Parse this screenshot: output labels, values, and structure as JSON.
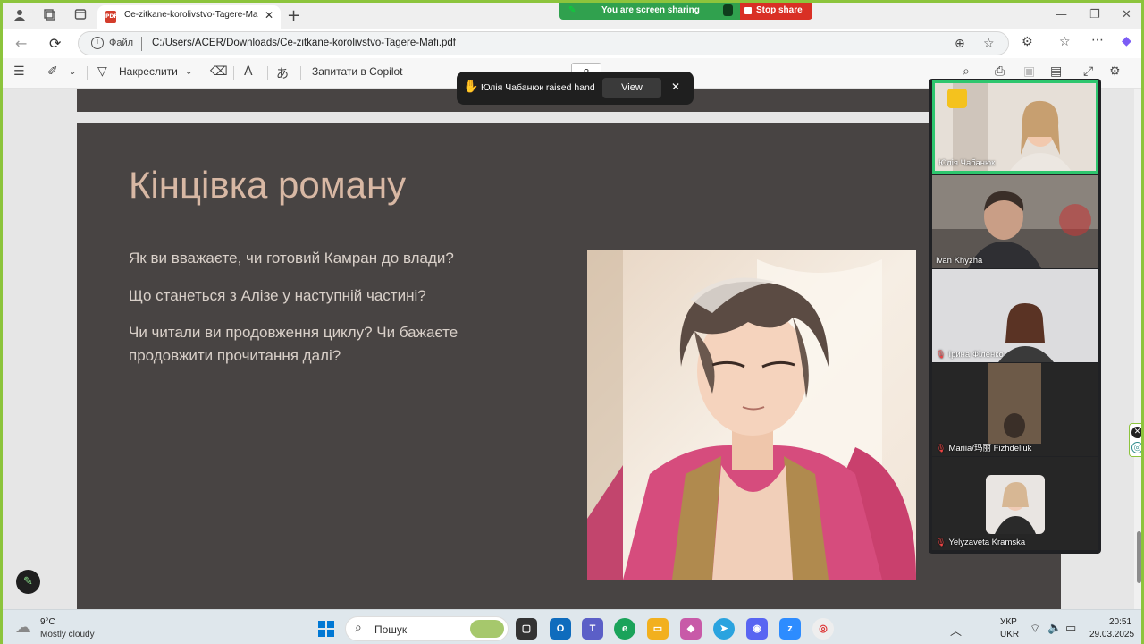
{
  "browser": {
    "tab_title": "Ce-zitkane-korolivstvo-Tagere-Ma",
    "address_label": "Файл",
    "address_url": "C:/Users/ACER/Downloads/Ce-zitkane-korolivstvo-Tagere-Mafi.pdf"
  },
  "screen_share": {
    "status_text": "You are screen sharing",
    "stop_label": "Stop share"
  },
  "pdf_toolbar": {
    "draw_label": "Накреслити",
    "copilot_label": "Запитати в Copilot",
    "page_number": "8"
  },
  "slide": {
    "title": "Кінцівка роману",
    "questions": [
      "Як ви вважаєте, чи готовий Камран до влади?",
      "Що станеться з Алізе у наступній частині?",
      "Чи читали ви продовження циклу? Чи бажаєте продовжити прочитання далі?"
    ]
  },
  "toast": {
    "message": "Юлія Чабанюк raised hand",
    "view_label": "View"
  },
  "participants": [
    {
      "name": "Юлія Чабанюк",
      "muted": false,
      "active": true,
      "bg": "#d9cfc6"
    },
    {
      "name": "Ivan Khyzha",
      "muted": false,
      "active": false,
      "bg": "#6e6862"
    },
    {
      "name": "Ірина Філенко",
      "muted": true,
      "active": false,
      "bg": "#d4d4d6"
    },
    {
      "name": "Mariia/玛丽 Fizhdeliuk",
      "muted": true,
      "active": false,
      "bg": "#2b2b2b"
    },
    {
      "name": "Yelyzaveta Kramska",
      "muted": true,
      "active": false,
      "bg": "#2b2b2b"
    }
  ],
  "taskbar": {
    "temperature": "9°C",
    "weather": "Mostly cloudy",
    "search_placeholder": "Пошук",
    "lang_top": "УКР",
    "lang_bottom": "UKR",
    "time": "20:51",
    "date": "29.03.2025"
  },
  "colors": {
    "accent_green": "#30a14e",
    "stop_red": "#d93025",
    "slide_bg": "#484443",
    "title_color": "#d8b8a4"
  }
}
